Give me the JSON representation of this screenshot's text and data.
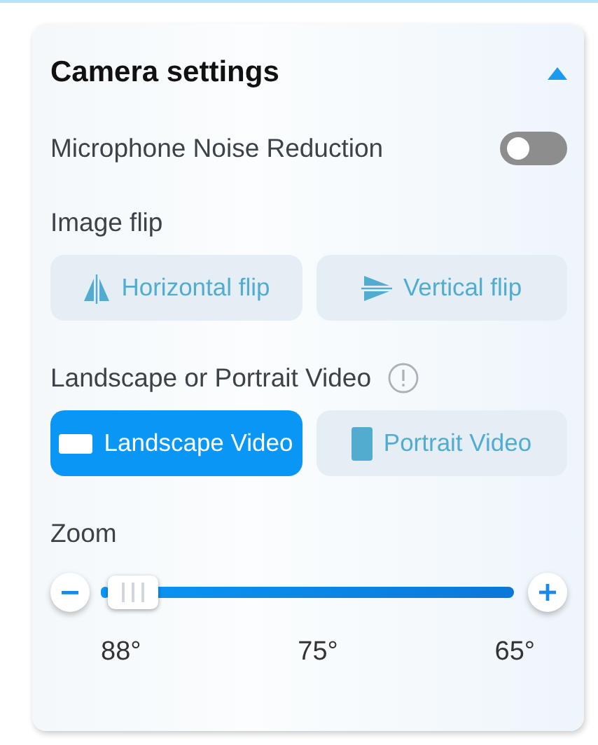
{
  "panel": {
    "title": "Camera settings",
    "expanded": true
  },
  "noise_reduction": {
    "label": "Microphone Noise Reduction",
    "on": false
  },
  "image_flip": {
    "label": "Image flip",
    "buttons": [
      {
        "kind": "horizontal",
        "label": "Horizontal flip",
        "selected": false
      },
      {
        "kind": "vertical",
        "label": "Vertical flip",
        "selected": false
      }
    ]
  },
  "orientation": {
    "label": "Landscape or Portrait Video",
    "buttons": [
      {
        "kind": "landscape",
        "label": "Landscape Video",
        "selected": true
      },
      {
        "kind": "portrait",
        "label": "Portrait Video",
        "selected": false
      }
    ]
  },
  "zoom": {
    "label": "Zoom",
    "level": 0.02,
    "ticks": [
      "88°",
      "75°",
      "65°"
    ]
  }
}
